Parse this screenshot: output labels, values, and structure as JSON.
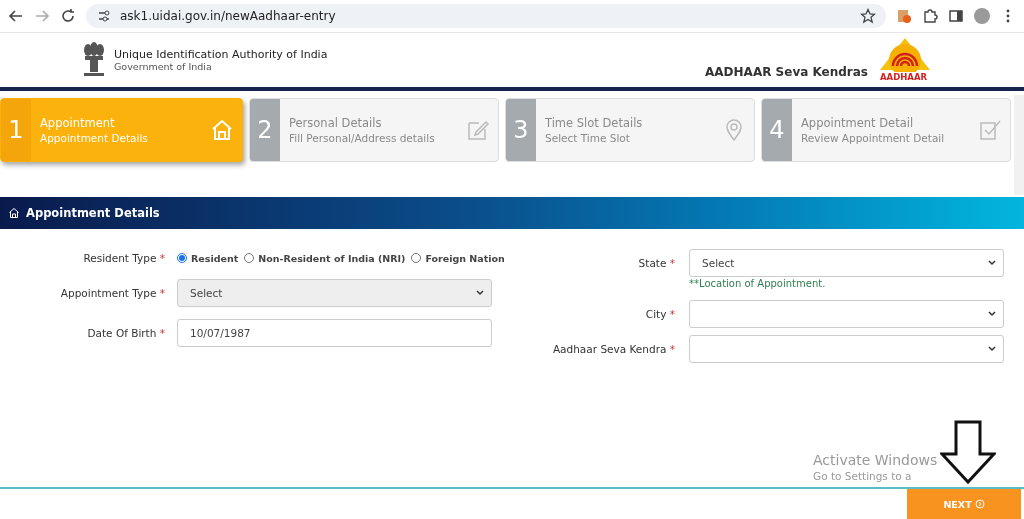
{
  "browser": {
    "url": "ask1.uidai.gov.in/newAadhaar-entry"
  },
  "header": {
    "org_name": "Unique Identification Authority of India",
    "org_sub": "Government of India",
    "brand": "AADHAAR Seva Kendras",
    "logo_text": "AADHAAR"
  },
  "steps": [
    {
      "number": "1",
      "title": "Appointment",
      "subtitle": "Appointment Details",
      "selected": true,
      "kind": "home"
    },
    {
      "number": "2",
      "title": "Personal Details",
      "subtitle": "Fill Personal/Address details",
      "selected": false,
      "kind": "edit"
    },
    {
      "number": "3",
      "title": "Time Slot Details",
      "subtitle": "Select Time Slot",
      "selected": false,
      "kind": "pin"
    },
    {
      "number": "4",
      "title": "Appointment Detail",
      "subtitle": "Review Appointment Detail",
      "selected": false,
      "kind": "check"
    }
  ],
  "section_title": "Appointment Details",
  "resident_type": {
    "label": "Resident Type",
    "required_mark": "*",
    "options": [
      {
        "label": "Resident",
        "selected": true
      },
      {
        "label": "Non-Resident of India (NRI)",
        "selected": false
      },
      {
        "label": "Foreign Nation",
        "selected": false
      }
    ]
  },
  "left_fields": [
    {
      "label": "Appointment Type",
      "required_mark": "*",
      "kind": "select",
      "value": "Select",
      "disabled": true
    },
    {
      "label": "Date Of Birth",
      "required_mark": "*",
      "kind": "input",
      "value": "10/07/1987",
      "disabled": false
    }
  ],
  "right_fields": [
    {
      "label": "State",
      "required_mark": "*",
      "value": "Select",
      "hint": "**Location of Appointment."
    },
    {
      "label": "City",
      "required_mark": "*"
    },
    {
      "label": "Aadhaar Seva Kendra",
      "required_mark": "*"
    }
  ],
  "next_button": "NEXT",
  "os_notice": {
    "title": "Activate Windows",
    "subtitle": "Go to Settings to a"
  }
}
